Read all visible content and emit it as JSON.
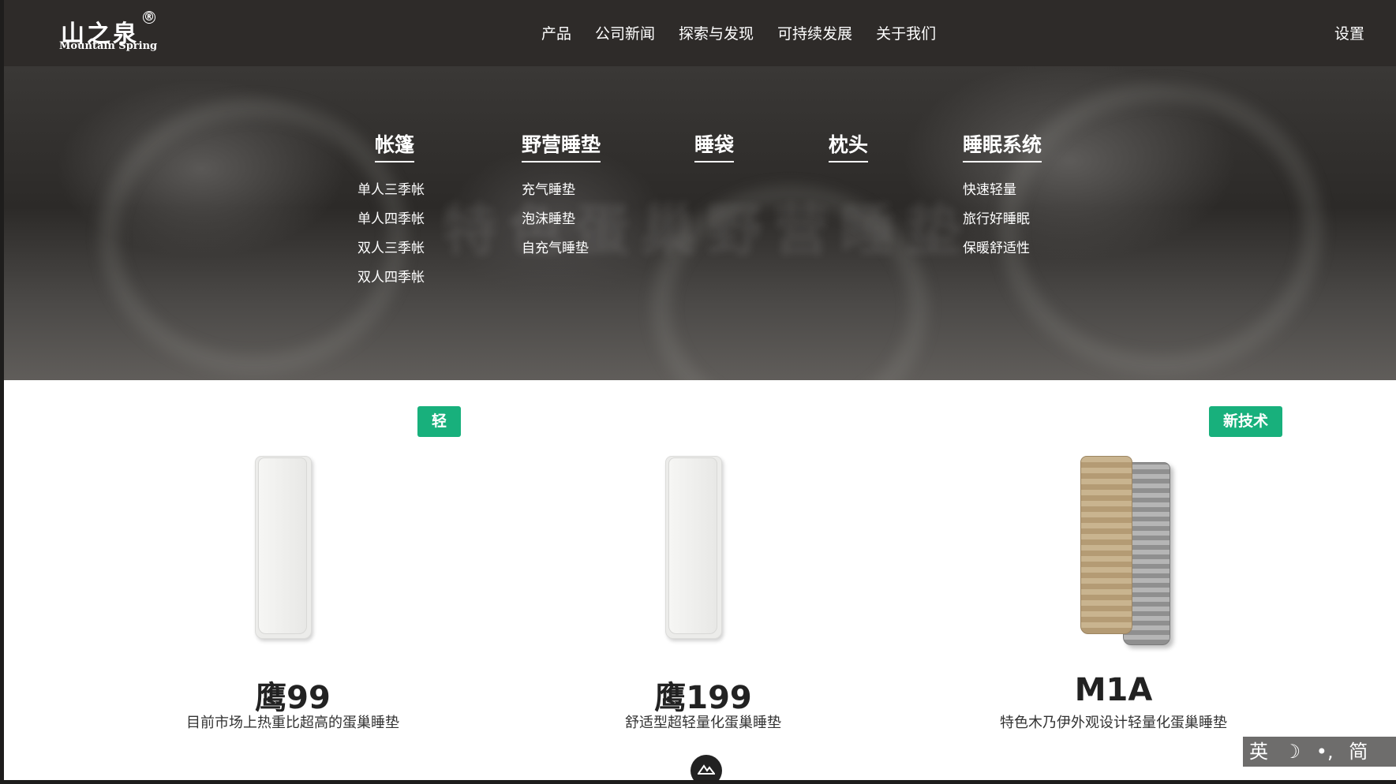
{
  "header": {
    "logo_cn": "山之泉",
    "logo_en": "Mountain Spring",
    "logo_mark": "®",
    "nav": [
      "产品",
      "公司新闻",
      "探索与发现",
      "可持续发展",
      "关于我们"
    ],
    "settings": "设置"
  },
  "menu": {
    "background_text": "特色蛋巢野营睡垫",
    "columns": [
      {
        "title": "帐篷",
        "items": [
          "单人三季帐",
          "单人四季帐",
          "双人三季帐",
          "双人四季帐"
        ]
      },
      {
        "title": "野营睡垫",
        "items": [
          "充气睡垫",
          "泡沫睡垫",
          "自充气睡垫"
        ]
      },
      {
        "title": "睡袋",
        "items": []
      },
      {
        "title": "枕头",
        "items": []
      },
      {
        "title": "睡眠系统",
        "items": [
          "快速轻量",
          "旅行好睡眠",
          "保暖舒适性"
        ]
      }
    ]
  },
  "products": [
    {
      "badge": "轻",
      "name": "鹰99",
      "desc": "目前市场上热重比超高的蛋巢睡垫",
      "color": "#f0f0ee"
    },
    {
      "badge": "",
      "name": "鹰199",
      "desc": "舒适型超轻量化蛋巢睡垫",
      "color": "#f0f0ee"
    },
    {
      "badge": "新技术",
      "name": "M1A",
      "desc": "特色木乃伊外观设计轻量化蛋巢睡垫",
      "color": "#b9a07a"
    }
  ],
  "ime": [
    "英",
    "☽",
    "•,",
    "简"
  ],
  "colors": {
    "accent": "#18b07c",
    "header": "#2e2b29"
  }
}
